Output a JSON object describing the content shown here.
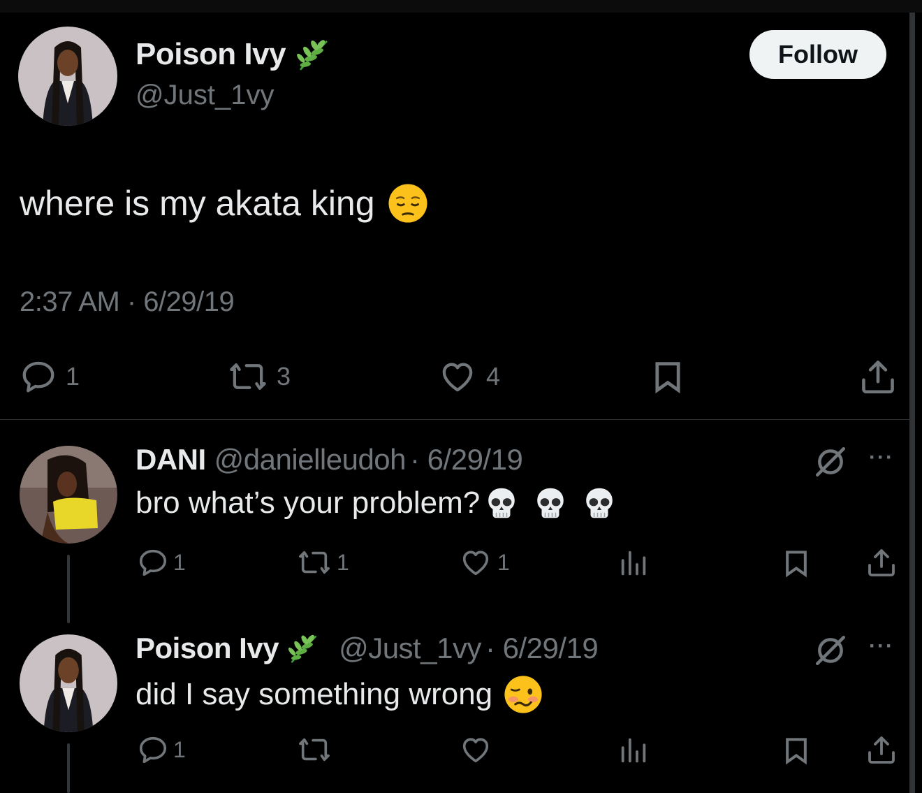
{
  "main_tweet": {
    "name": "Poison Ivy",
    "handle": "@Just_1vy",
    "follow_label": "Follow",
    "text": "where is my akata king",
    "timestamp": "2:37 AM · 6/29/19",
    "reply_count": "1",
    "repost_count": "3",
    "like_count": "4"
  },
  "replies": [
    {
      "name": "DANI",
      "handle": "@danielleudoh",
      "date": "· 6/29/19",
      "text": "bro what’s your problem?",
      "reply_count": "1",
      "repost_count": "1",
      "like_count": "1",
      "more": "···"
    },
    {
      "name": "Poison Ivy",
      "handle": "@Just_1vy",
      "date": "· 6/29/19",
      "text": "did I say something wrong",
      "reply_count": "1",
      "repost_count": "",
      "like_count": "",
      "more": "···"
    }
  ],
  "colors": {
    "background": "#000000",
    "primary_text": "#e7e9ea",
    "secondary_text": "#71767b",
    "divider": "#2f3336",
    "follow_bg": "#eff3f4"
  },
  "icons": [
    "herb-icon",
    "reply-icon",
    "repost-icon",
    "like-icon",
    "bookmark-icon",
    "share-icon",
    "views-icon",
    "grok-icon",
    "more-icon",
    "pensive-emoji",
    "skull-emoji",
    "woozy-emoji"
  ]
}
